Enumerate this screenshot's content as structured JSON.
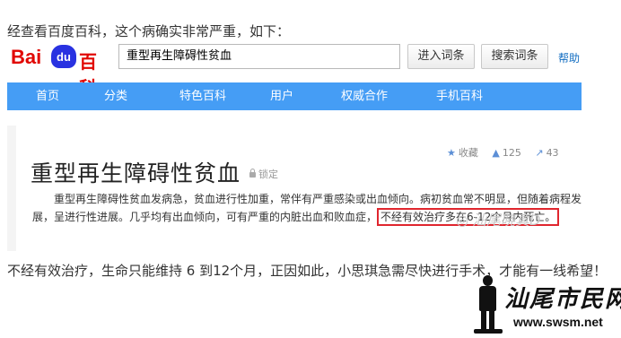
{
  "intro": "经查看百度百科，这个病确实非常严重，如下：",
  "baike": {
    "logo": {
      "bai": "Bai",
      "du": "du",
      "ke": "百科"
    },
    "search_value": "重型再生障碍性贫血",
    "enter_label": "进入词条",
    "search_label": "搜索词条",
    "help_label": "帮助",
    "nav": [
      "首页",
      "分类",
      "特色百科",
      "用户",
      "权威合作",
      "手机百科"
    ],
    "colors": {
      "nav_bg": "#459df5",
      "logo_red": "#e10601",
      "logo_blue": "#2932e1",
      "highlight": "#e0262e"
    }
  },
  "article": {
    "title": "重型再生障碍性贫血",
    "lock_label": "锁定",
    "stats": {
      "collect_icon": "star-icon",
      "collect_label": "收藏",
      "like_icon": "thumb-up-icon",
      "likes": "125",
      "share_icon": "share-icon",
      "shares": "43"
    },
    "para_part1": "重型再生障碍性贫血发病急，贫血进行性加重，常伴有严重感染或出血倾向。病初贫血常不明显，但随着病程发展，呈进行性进展。几乎均有出血倾向，可有严重的内脏出血和败血症，",
    "para_highlight": "不经有效治疗多在6-12个月内死亡。",
    "watermark": "汕尾晓真D"
  },
  "outro": "不经有效治疗，生命只能维持 6 到12个月，正因如此，小思琪急需尽快进行手术，才能有一线希望！",
  "site": {
    "name": "汕尾市民网",
    "url": "www.swsm.net"
  }
}
